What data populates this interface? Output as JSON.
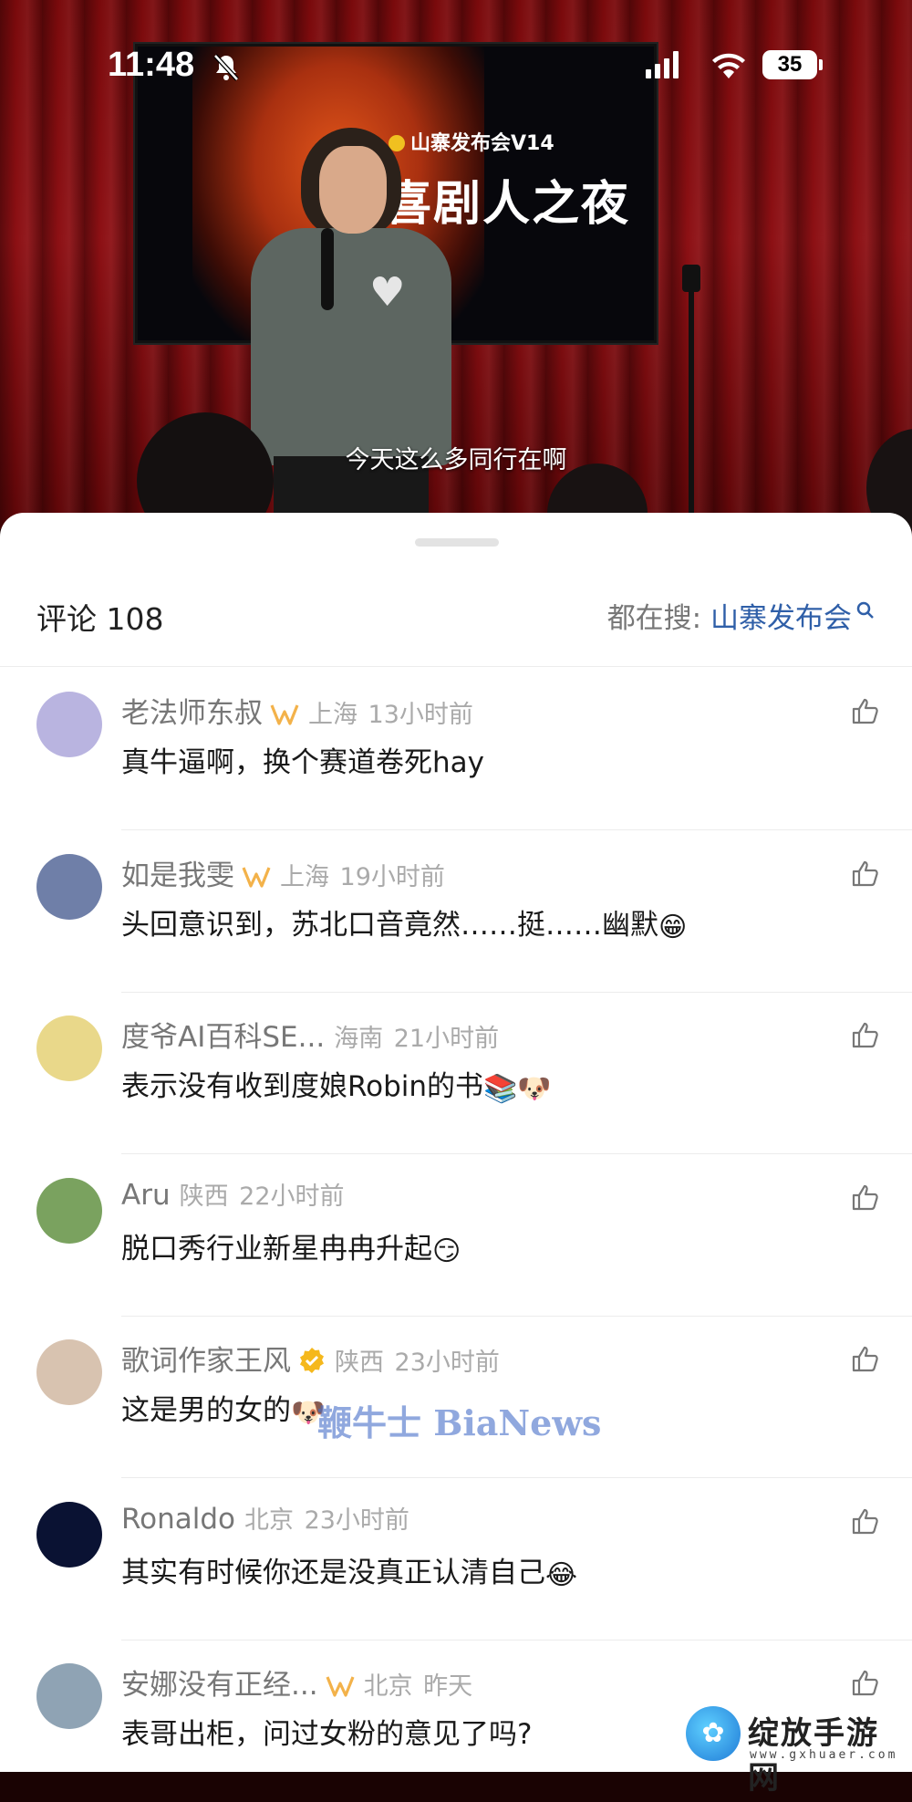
{
  "status_bar": {
    "time": "11:48",
    "battery": "35"
  },
  "video": {
    "screen_logo": "山寨发布会V14",
    "screen_title": "喜剧人之夜",
    "subtitle": "今天这么多同行在啊"
  },
  "comments_header": {
    "count_label": "评论 108",
    "search_prefix": "都在搜:",
    "search_keyword": "山寨发布会"
  },
  "comments": [
    {
      "user": "老法师东叔",
      "badge": "vip",
      "location": "上海",
      "time": "13小时前",
      "text": "真牛逼啊，换个赛道卷死hay",
      "emoji": "",
      "avatar_color": "#b9b4e0"
    },
    {
      "user": "如是我雯",
      "badge": "vip",
      "location": "上海",
      "time": "19小时前",
      "text": "头回意识到，苏北口音竟然……挺……幽默",
      "emoji": "😁",
      "avatar_color": "#6f7fa8"
    },
    {
      "user": "度爷AI百科SE...",
      "badge": "",
      "location": "海南",
      "time": "21小时前",
      "text": "表示没有收到度娘Robin的书",
      "emoji": "📚🐶",
      "avatar_color": "#e9d88a"
    },
    {
      "user": "Aru",
      "badge": "",
      "location": "陕西",
      "time": "22小时前",
      "text": "脱口秀行业新星冉冉升起",
      "emoji": "😏",
      "avatar_color": "#7aa25f"
    },
    {
      "user": "歌词作家王风",
      "badge": "verified",
      "location": "陕西",
      "time": "23小时前",
      "text": "这是男的女的",
      "emoji": "🐶",
      "avatar_color": "#d8c3b0"
    },
    {
      "user": "Ronaldo",
      "badge": "",
      "location": "北京",
      "time": "23小时前",
      "text": "其实有时候你还是没真正认清自己",
      "emoji": "😂",
      "avatar_color": "#0a1233"
    },
    {
      "user": "安娜没有正经...",
      "badge": "vip",
      "location": "北京",
      "time": "昨天",
      "text": "表哥出柜，问过女粉的意见了吗?",
      "emoji": "",
      "avatar_color": "#8fa3b4"
    }
  ],
  "overlays": {
    "watermark": "鞭牛士 BiaNews",
    "site_name": "绽放手游网",
    "site_url": "www.gxhuaer.com"
  }
}
